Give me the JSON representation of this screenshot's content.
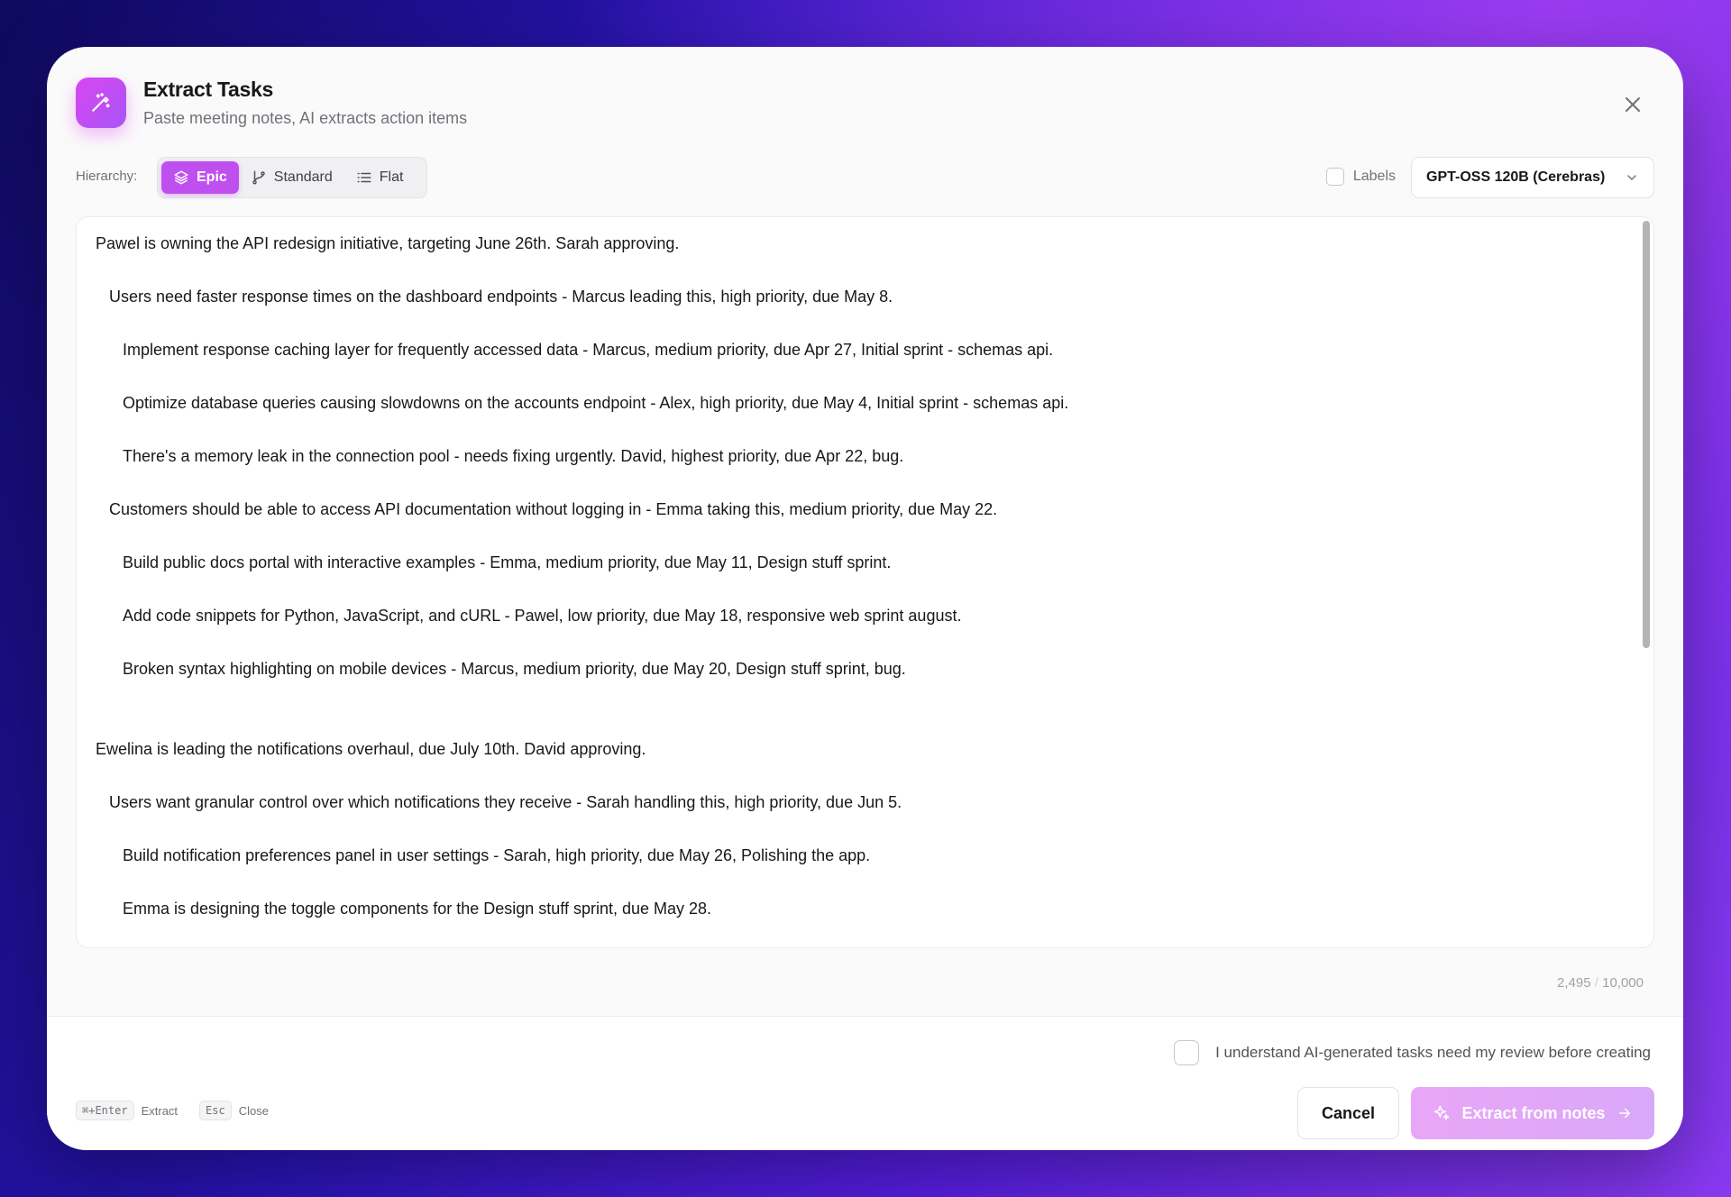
{
  "header": {
    "title": "Extract Tasks",
    "subtitle": "Paste meeting notes, AI extracts action items",
    "icon": "magic-wand-icon"
  },
  "toolbar": {
    "hierarchy_label": "Hierarchy:",
    "hierarchy_options": [
      {
        "label": "Epic",
        "icon": "layers-icon",
        "active": true
      },
      {
        "label": "Standard",
        "icon": "git-branch-icon",
        "active": false
      },
      {
        "label": "Flat",
        "icon": "list-icon",
        "active": false
      }
    ],
    "labels_toggle": {
      "label": "Labels",
      "checked": false
    },
    "model_select": {
      "value": "GPT-OSS 120B (Cerebras)"
    }
  },
  "notes": [
    "Pawel is owning the API redesign initiative, targeting June 26th. Sarah approving.",
    "Users need faster response times on the dashboard endpoints - Marcus leading this, high priority, due May 8.",
    "Implement response caching layer for frequently accessed data - Marcus, medium priority, due Apr 27, Initial sprint - schemas api.",
    "Optimize database queries causing slowdowns on the accounts endpoint - Alex, high priority, due May 4, Initial sprint - schemas api.",
    "There's a memory leak in the connection pool - needs fixing urgently. David, highest priority, due Apr 22, bug.",
    "Customers should be able to access API documentation without logging in - Emma taking this, medium priority, due May 22.",
    "Build public docs portal with interactive examples - Emma, medium priority, due May 11, Design stuff sprint.",
    "Add code snippets for Python, JavaScript, and cURL - Pawel, low priority, due May 18, responsive web sprint august.",
    "Broken syntax highlighting on mobile devices - Marcus, medium priority, due May 20, Design stuff sprint, bug.",
    "Ewelina is leading the notifications overhaul, due July 10th. David approving.",
    "Users want granular control over which notifications they receive - Sarah handling this, high priority, due Jun 5.",
    "Build notification preferences panel in user settings - Sarah, high priority, due May 26, Polishing the app.",
    "Emma is designing the toggle components for the Design stuff sprint, due May 28."
  ],
  "counter": {
    "current": "2,495",
    "separator": "/",
    "max": "10,000"
  },
  "footer": {
    "ack_label": "I understand AI-generated tasks need my review before creating",
    "ack_checked": false,
    "shortcuts": [
      {
        "key": "⌘+Enter",
        "label": "Extract"
      },
      {
        "key": "Esc",
        "label": "Close"
      }
    ],
    "cancel_label": "Cancel",
    "extract_label": "Extract from notes"
  },
  "colors": {
    "accent": "#c04ff0",
    "extract_button_disabled": "#e3a8f8"
  }
}
